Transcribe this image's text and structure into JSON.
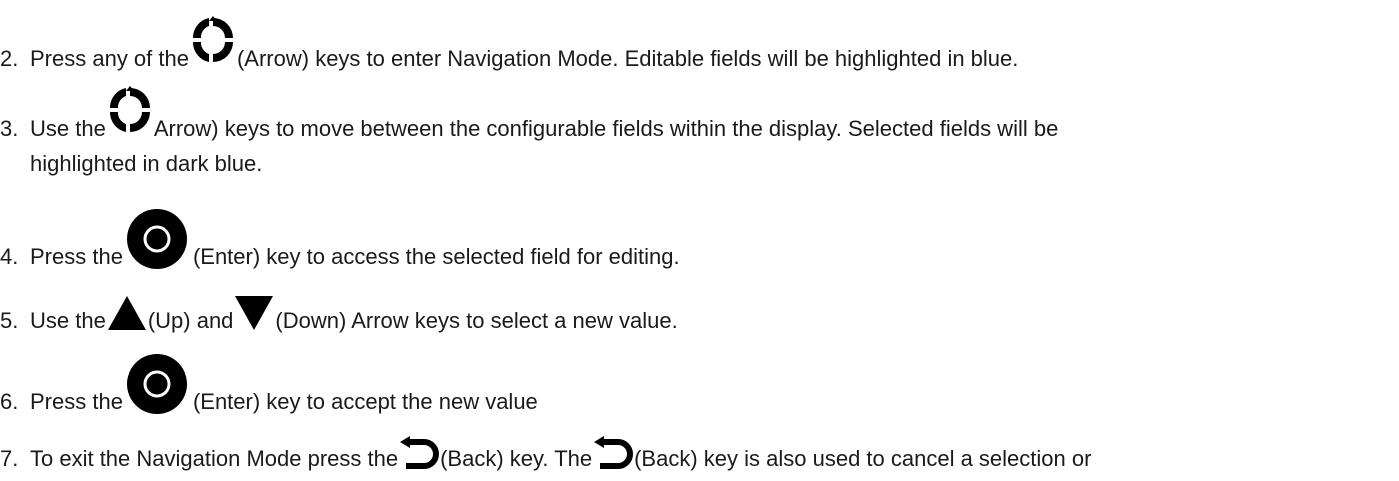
{
  "colors": {
    "text": "#1a1a1a",
    "icon": "#000000",
    "icon_ring": "#ffffff"
  },
  "icons": {
    "arrows": "four-way-arrow-keys-icon",
    "enter": "enter-key-icon",
    "up": "up-triangle-icon",
    "down": "down-triangle-icon",
    "back": "back-key-icon"
  },
  "steps": [
    {
      "num": "2.",
      "pre": "Press any of the ",
      "post": "(Arrow) keys to enter Navigation Mode. Editable fields will be highlighted in blue."
    },
    {
      "num": "3.",
      "pre": "Use the ",
      "post": "Arrow) keys to move between the configurable fields within the display. Selected fields will be",
      "cont": "highlighted in dark blue."
    },
    {
      "num": "4.",
      "pre": "Press the ",
      "post": "(Enter) key to access the selected field for editing."
    },
    {
      "num": "5.",
      "pre": "Use the ",
      "mid": "(Up) and ",
      "post": "(Down) Arrow keys to select a new value."
    },
    {
      "num": "6.",
      "pre": "Press the ",
      "post": "(Enter) key to accept the new value"
    },
    {
      "num": "7.",
      "pre": "To exit the Navigation Mode press the ",
      "mid": " (Back) key. The ",
      "post": "(Back) key is also used to cancel a selection or"
    }
  ]
}
